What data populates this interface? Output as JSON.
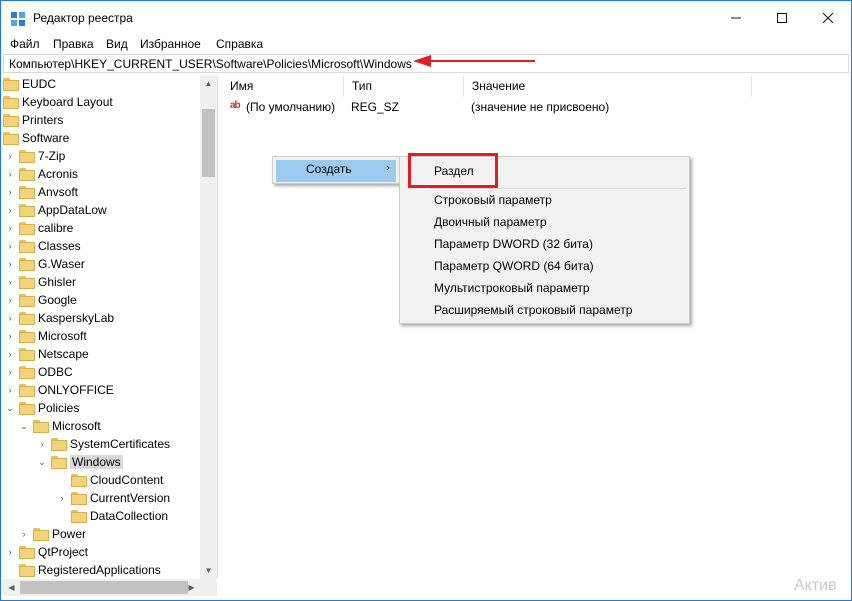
{
  "window": {
    "title": "Редактор реестра",
    "minimize_icon": "minimize-icon",
    "maximize_icon": "maximize-icon",
    "close_icon": "close-icon",
    "border_color": "#1e7be0"
  },
  "menubar": {
    "items": [
      "Файл",
      "Правка",
      "Вид",
      "Избранное",
      "Справка"
    ]
  },
  "address": {
    "path": "Компьютер\\HKEY_CURRENT_USER\\Software\\Policies\\Microsoft\\Windows",
    "annotation_color": "#e02020"
  },
  "tree": {
    "items": [
      {
        "label": "EUDC"
      },
      {
        "label": "Keyboard Layout"
      },
      {
        "label": "Printers"
      },
      {
        "label": "Software"
      },
      {
        "label": "7-Zip"
      },
      {
        "label": "Acronis"
      },
      {
        "label": "Anvsoft"
      },
      {
        "label": "AppDataLow"
      },
      {
        "label": "calibre"
      },
      {
        "label": "Classes"
      },
      {
        "label": "G.Waser"
      },
      {
        "label": "Ghisler"
      },
      {
        "label": "Google"
      },
      {
        "label": "KasperskyLab"
      },
      {
        "label": "Microsoft"
      },
      {
        "label": "Netscape"
      },
      {
        "label": "ODBC"
      },
      {
        "label": "ONLYOFFICE"
      },
      {
        "label": "Policies"
      },
      {
        "label": "Microsoft"
      },
      {
        "label": "SystemCertificates"
      },
      {
        "label": "Windows"
      },
      {
        "label": "CloudContent"
      },
      {
        "label": "CurrentVersion"
      },
      {
        "label": "DataCollection"
      },
      {
        "label": "Power"
      },
      {
        "label": "QtProject"
      },
      {
        "label": "RegisteredApplications"
      }
    ],
    "selected": "Windows"
  },
  "values": {
    "headers": {
      "name": "Имя",
      "type": "Тип",
      "value": "Значение"
    },
    "rows": [
      {
        "icon": "string-value-icon",
        "name": "(По умолчанию)",
        "type": "REG_SZ",
        "value": "(значение не присвоено)"
      }
    ]
  },
  "context_menu": {
    "item": "Создать",
    "submenu": [
      "Раздел",
      "Строковый параметр",
      "Двоичный параметр",
      "Параметр DWORD (32 бита)",
      "Параметр QWORD (64 бита)",
      "Мультистроковый параметр",
      "Расширяемый строковый параметр"
    ],
    "highlight_color": "#9ccbf2"
  },
  "watermark": "Актив"
}
